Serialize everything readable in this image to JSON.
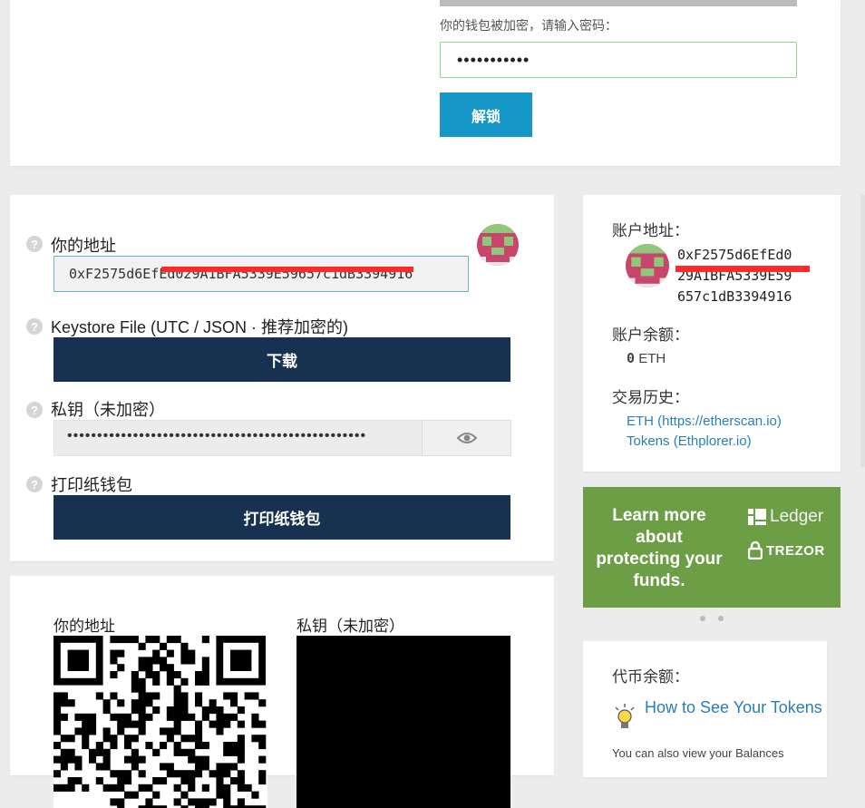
{
  "unlock": {
    "password_label": "你的钱包被加密，请输入密码：",
    "password_value": "•••••••••••",
    "unlock_button": "解锁"
  },
  "wallet": {
    "address_label": "你的地址",
    "address_value": "0xF2575d6EfEd029A1BFA5339E59657c1dB3394916",
    "keystore_label": "Keystore File (UTC / JSON · 推荐加密的)",
    "download_button": "下载",
    "privkey_label": "私钥（未加密）",
    "privkey_value": "••••••••••••••••••••••••••••••••••••••••••••••••••",
    "print_label": "打印纸钱包",
    "print_button": "打印纸钱包",
    "help_icon": "?"
  },
  "qr": {
    "address_label": "你的地址",
    "privkey_label": "私钥（未加密）"
  },
  "account": {
    "address_title": "账户地址：",
    "address_value": "0xF2575d6EfEd0\n29A1BFA5339E59\n657c1dB3394916",
    "balance_title": "账户余额：",
    "balance_amount": "0",
    "balance_unit": "ETH",
    "history_title": "交易历史：",
    "history_links": [
      "ETH (https://etherscan.io)",
      "Tokens (Ethplorer.io)"
    ]
  },
  "banner": {
    "text": "Learn more about protecting your funds.",
    "ledger": "Ledger",
    "trezor": "TREZOR",
    "color": "#6b9e45"
  },
  "tokens": {
    "title": "代币余额：",
    "link": "How to See Your Tokens",
    "note": "You can also view your Balances"
  },
  "colors": {
    "primary_button": "#1597c7",
    "dark_button": "#163250",
    "link": "#2a7fb5",
    "redaction": "#ff2a2a"
  }
}
